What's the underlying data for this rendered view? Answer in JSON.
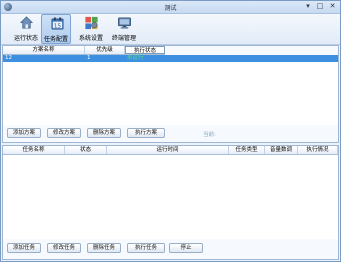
{
  "window": {
    "title": "测试"
  },
  "titlebar": {
    "minimize": "▾",
    "maximize": "□",
    "close": "✕"
  },
  "toolbar": {
    "items": [
      {
        "label": "运行状态",
        "icon": "home-icon"
      },
      {
        "label": "任务配置",
        "icon": "calendar-icon"
      },
      {
        "label": "系统设置",
        "icon": "settings-icon"
      },
      {
        "label": "终端管理",
        "icon": "monitor-icon"
      }
    ]
  },
  "plans": {
    "columns": [
      "方案名称",
      "优先级",
      "执行状态"
    ],
    "rows": [
      {
        "name": "12",
        "priority": "1",
        "status": "未运行"
      }
    ],
    "buttons": {
      "add": "添加方案",
      "edit": "修改方案",
      "delete": "删除方案",
      "run": "执行方案"
    },
    "status_text": "当前:"
  },
  "tasks": {
    "columns": [
      "任务名称",
      "状态",
      "运行时间",
      "任务类型",
      "音量数调",
      "执行情况"
    ],
    "rows": [],
    "buttons": {
      "add": "添加任务",
      "edit": "修改任务",
      "delete": "删除任务",
      "run": "执行任务",
      "stop": "停止"
    }
  },
  "colors": {
    "selection": "#3d8fe0",
    "status_running": "#55e07a"
  }
}
